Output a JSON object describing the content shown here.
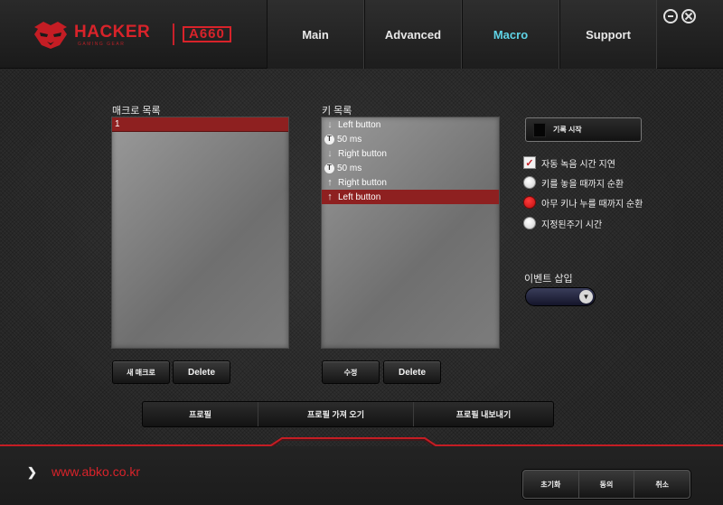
{
  "brand": {
    "name": "HACKER",
    "subtitle": "GAMING GEAR",
    "model": "A660"
  },
  "tabs": [
    {
      "label": "Main",
      "active": false
    },
    {
      "label": "Advanced",
      "active": false
    },
    {
      "label": "Macro",
      "active": true
    },
    {
      "label": "Support",
      "active": false
    }
  ],
  "macro_list": {
    "title": "매크로 목록",
    "items": [
      "1"
    ],
    "selected_index": 0
  },
  "key_list": {
    "title": "키 목록",
    "items": [
      {
        "icon": "arrow-down-icon",
        "text": "Left button"
      },
      {
        "icon": "timer-icon",
        "text": "50 ms"
      },
      {
        "icon": "arrow-down-icon",
        "text": "Right button"
      },
      {
        "icon": "timer-icon",
        "text": "50 ms"
      },
      {
        "icon": "arrow-up-icon",
        "text": "Right button"
      },
      {
        "icon": "arrow-up-icon",
        "text": "Left button"
      }
    ],
    "selected_index": 5
  },
  "buttons": {
    "new_macro": "새 매크로",
    "delete_macro": "Delete",
    "edit_key": "수정",
    "delete_key": "Delete"
  },
  "record": {
    "label": "기록 시작"
  },
  "options": {
    "auto_delay": {
      "label": "자동 녹음 시간 지연",
      "checked": true
    },
    "playback_modes": [
      {
        "label": "키를 놓을 때까지 순환",
        "selected": false
      },
      {
        "label": "아무 키나 누를 때까지 순환",
        "selected": true
      },
      {
        "label": "지정된주기 시간",
        "selected": false
      }
    ]
  },
  "event_insert": {
    "label": "이벤트 삽입",
    "value": ""
  },
  "profile_bar": {
    "profile": "프로필",
    "import": "프로필 가져 오기",
    "export": "프로필 내보내기"
  },
  "footer": {
    "website": "www.abko.co.kr",
    "reset": "초기화",
    "apply": "동의",
    "cancel": "취소"
  },
  "colors": {
    "brand_red": "#d8232a",
    "active_tab": "#5fd3e6",
    "selection": "#8e2020"
  }
}
